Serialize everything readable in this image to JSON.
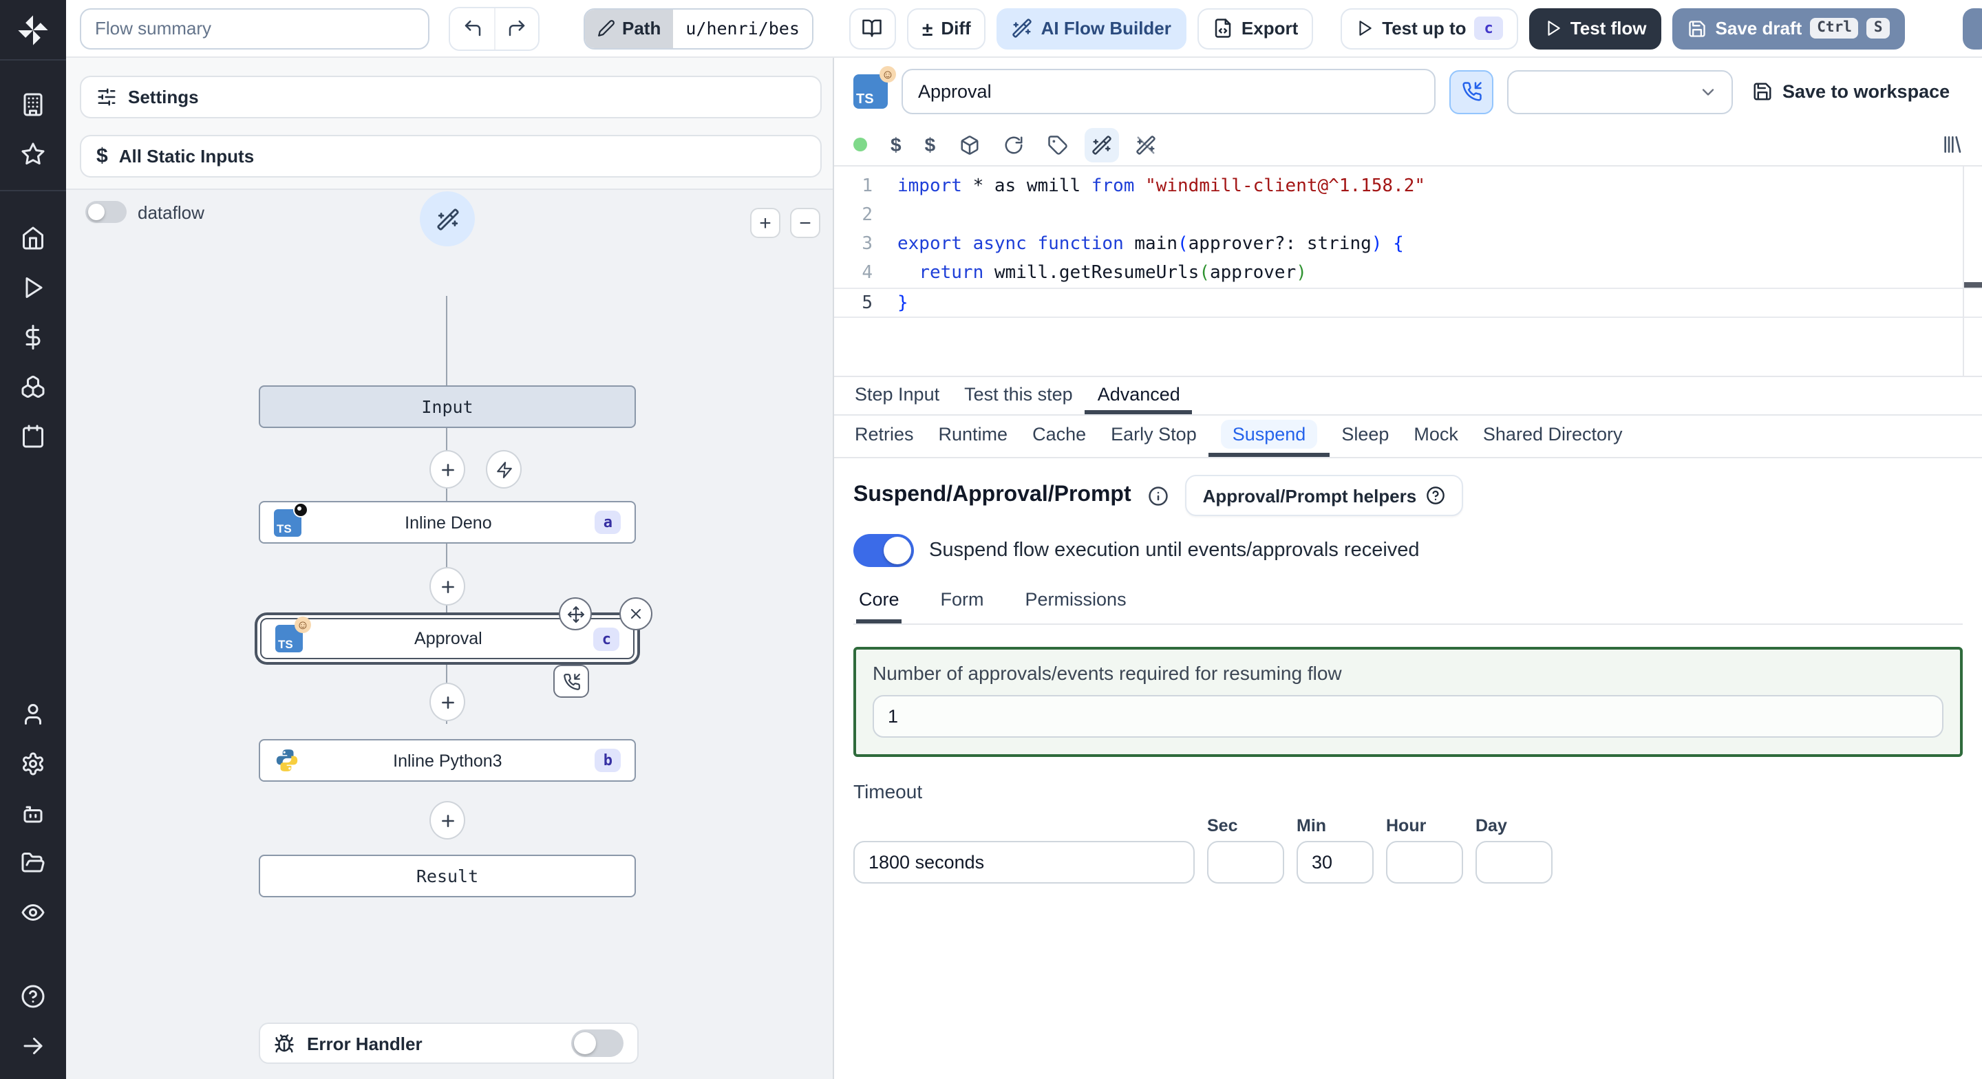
{
  "topbar": {
    "flow_summary_placeholder": "Flow summary",
    "path_label": "Path",
    "path_value": "u/henri/bes",
    "diff_symbol": "±",
    "diff_label": "Diff",
    "ai_flow_builder_label": "AI Flow Builder",
    "export_label": "Export",
    "test_up_to_label": "Test up to",
    "test_up_to_badge": "c",
    "test_flow_label": "Test flow",
    "save_draft_label": "Save draft",
    "save_draft_kbd": [
      "Ctrl",
      "S"
    ]
  },
  "left_panel": {
    "settings_label": "Settings",
    "static_inputs_label": "All Static Inputs",
    "dataflow_label": "dataflow",
    "zoom_in": "+",
    "zoom_out": "−",
    "error_handler_label": "Error Handler"
  },
  "flow_graph": {
    "nodes": [
      {
        "label": "Input",
        "type": "input"
      },
      {
        "label": "Inline Deno",
        "badge": "a",
        "lang": "deno"
      },
      {
        "label": "Approval",
        "badge": "c",
        "lang": "deno",
        "selected": true
      },
      {
        "label": "Inline Python3",
        "badge": "b",
        "lang": "python"
      },
      {
        "label": "Result",
        "type": "result"
      }
    ]
  },
  "step_editor": {
    "language_badge": "TS",
    "name_value": "Approval",
    "save_to_workspace_label": "Save to workspace"
  },
  "code": {
    "lines": [
      {
        "num": "1",
        "tokens": [
          {
            "t": "import ",
            "c": "kw"
          },
          {
            "t": "* as wmill ",
            "c": "def"
          },
          {
            "t": "from ",
            "c": "kw"
          },
          {
            "t": "\"windmill-client@^1.158.2\"",
            "c": "str"
          }
        ]
      },
      {
        "num": "2",
        "tokens": []
      },
      {
        "num": "3",
        "tokens": [
          {
            "t": "export async function ",
            "c": "kw"
          },
          {
            "t": "main",
            "c": "def"
          },
          {
            "t": "(",
            "c": "pb"
          },
          {
            "t": "approver?: string",
            "c": "def"
          },
          {
            "t": ") ",
            "c": "pb"
          },
          {
            "t": "{",
            "c": "pb"
          }
        ]
      },
      {
        "num": "4",
        "tokens": [
          {
            "t": "  ",
            "c": "def"
          },
          {
            "t": "return",
            "c": "kw"
          },
          {
            "t": " wmill.getResumeUrls",
            "c": "def"
          },
          {
            "t": "(",
            "c": "pg"
          },
          {
            "t": "approver",
            "c": "def"
          },
          {
            "t": ")",
            "c": "pg"
          }
        ]
      },
      {
        "num": "5",
        "tokens": [
          {
            "t": "}",
            "c": "pb"
          }
        ]
      }
    ]
  },
  "tabs_primary": {
    "items": [
      {
        "label": "Step Input"
      },
      {
        "label": "Test this step"
      },
      {
        "label": "Advanced",
        "active": true
      }
    ]
  },
  "tabs_advanced": {
    "items": [
      {
        "label": "Retries"
      },
      {
        "label": "Runtime"
      },
      {
        "label": "Cache"
      },
      {
        "label": "Early Stop"
      },
      {
        "label": "Suspend",
        "active": true
      },
      {
        "label": "Sleep"
      },
      {
        "label": "Mock"
      },
      {
        "label": "Shared Directory"
      }
    ]
  },
  "suspend": {
    "heading": "Suspend/Approval/Prompt",
    "helpers_button_label": "Approval/Prompt helpers",
    "toggle_label": "Suspend flow execution until events/approvals received",
    "toggle_on": true,
    "subtabs": [
      {
        "label": "Core",
        "active": true
      },
      {
        "label": "Form"
      },
      {
        "label": "Permissions"
      }
    ],
    "approvals_label": "Number of approvals/events required for resuming flow",
    "approvals_value": "1",
    "timeout_label": "Timeout",
    "timeout_value": "1800 seconds",
    "timeout_units": [
      {
        "label": "Sec",
        "value": ""
      },
      {
        "label": "Min",
        "value": "30"
      },
      {
        "label": "Hour",
        "value": ""
      },
      {
        "label": "Day",
        "value": ""
      }
    ]
  },
  "colors": {
    "accent_blue": "#2563eb",
    "toggle_on": "#3b6be8",
    "save_draft_button": "#7289ac",
    "dark_button": "#2b3442",
    "step_badge_bg": "#e0e4fc",
    "step_badge_text": "#4338ca",
    "suspend_box_border": "#2f6b3c",
    "sidebar_bg": "#22252e"
  }
}
